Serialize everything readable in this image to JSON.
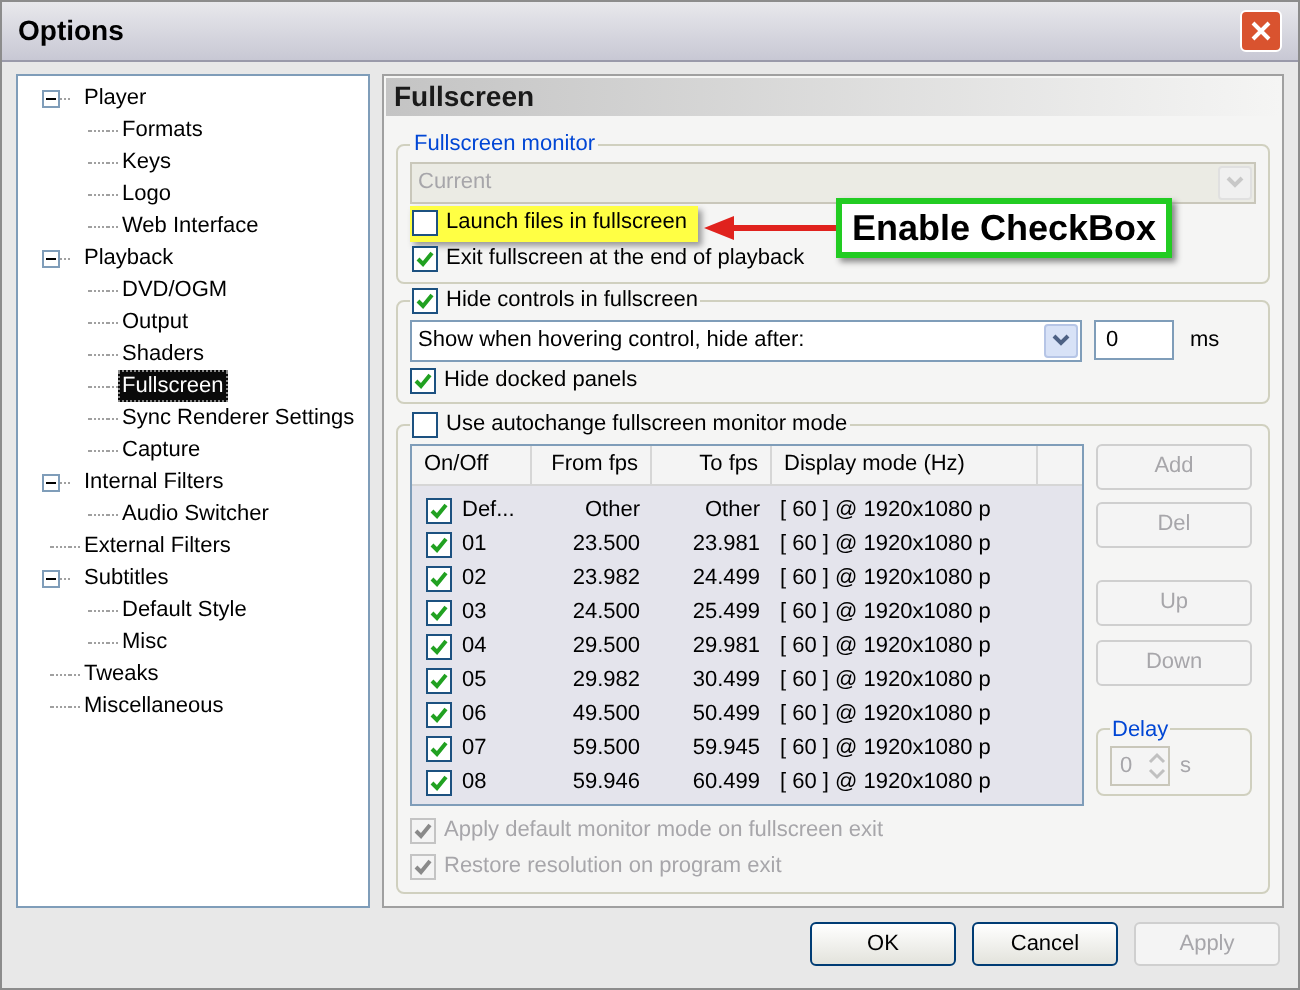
{
  "window": {
    "title": "Options"
  },
  "tree": [
    {
      "label": "Player",
      "expanded": true,
      "selected": false,
      "children": [
        {
          "label": "Formats",
          "selected": false
        },
        {
          "label": "Keys",
          "selected": false
        },
        {
          "label": "Logo",
          "selected": false
        },
        {
          "label": "Web Interface",
          "selected": false
        }
      ]
    },
    {
      "label": "Playback",
      "expanded": true,
      "selected": false,
      "children": [
        {
          "label": "DVD/OGM",
          "selected": false
        },
        {
          "label": "Output",
          "selected": false
        },
        {
          "label": "Shaders",
          "selected": false
        },
        {
          "label": "Fullscreen",
          "selected": true
        },
        {
          "label": "Sync Renderer Settings",
          "selected": false
        },
        {
          "label": "Capture",
          "selected": false
        }
      ]
    },
    {
      "label": "Internal Filters",
      "expanded": true,
      "selected": false,
      "children": [
        {
          "label": "Audio Switcher",
          "selected": false
        }
      ]
    },
    {
      "label": "External Filters",
      "selected": false
    },
    {
      "label": "Subtitles",
      "expanded": true,
      "selected": false,
      "children": [
        {
          "label": "Default Style",
          "selected": false
        },
        {
          "label": "Misc",
          "selected": false
        }
      ]
    },
    {
      "label": "Tweaks",
      "selected": false
    },
    {
      "label": "Miscellaneous",
      "selected": false
    }
  ],
  "panel": {
    "title": "Fullscreen",
    "monitor_group": {
      "label": "Fullscreen monitor",
      "dropdown": {
        "value": "Current",
        "disabled": true
      },
      "checkboxes": [
        {
          "label": "Launch files in fullscreen",
          "checked": false,
          "highlighted": true
        },
        {
          "label": "Exit fullscreen at the end of playback",
          "checked": true,
          "highlighted": false
        }
      ]
    },
    "controls_group": {
      "label": "Hide controls in fullscreen",
      "checked": true,
      "dropdown": {
        "value": "Show when hovering control, hide after:"
      },
      "delay": {
        "value": "0",
        "unit": "ms"
      },
      "docked": {
        "label": "Hide docked panels",
        "checked": true
      }
    },
    "autochange_group": {
      "label": "Use autochange fullscreen monitor mode",
      "checked": false,
      "table": {
        "columns": [
          "On/Off",
          "From fps",
          "To fps",
          "Display mode (Hz)"
        ],
        "rows": [
          {
            "checked": true,
            "name": "Def...",
            "from": "Other",
            "to": "Other",
            "mode": "[ 60 ] @ 1920x1080 p"
          },
          {
            "checked": true,
            "name": "01",
            "from": "23.500",
            "to": "23.981",
            "mode": "[ 60 ] @ 1920x1080 p"
          },
          {
            "checked": true,
            "name": "02",
            "from": "23.982",
            "to": "24.499",
            "mode": "[ 60 ] @ 1920x1080 p"
          },
          {
            "checked": true,
            "name": "03",
            "from": "24.500",
            "to": "25.499",
            "mode": "[ 60 ] @ 1920x1080 p"
          },
          {
            "checked": true,
            "name": "04",
            "from": "29.500",
            "to": "29.981",
            "mode": "[ 60 ] @ 1920x1080 p"
          },
          {
            "checked": true,
            "name": "05",
            "from": "29.982",
            "to": "30.499",
            "mode": "[ 60 ] @ 1920x1080 p"
          },
          {
            "checked": true,
            "name": "06",
            "from": "49.500",
            "to": "50.499",
            "mode": "[ 60 ] @ 1920x1080 p"
          },
          {
            "checked": true,
            "name": "07",
            "from": "59.500",
            "to": "59.945",
            "mode": "[ 60 ] @ 1920x1080 p"
          },
          {
            "checked": true,
            "name": "08",
            "from": "59.946",
            "to": "60.499",
            "mode": "[ 60 ] @ 1920x1080 p"
          }
        ]
      },
      "side_buttons": [
        {
          "label": "Add",
          "disabled": true
        },
        {
          "label": "Del",
          "disabled": true
        },
        {
          "label": "Up",
          "disabled": true
        },
        {
          "label": "Down",
          "disabled": true
        }
      ],
      "delay": {
        "label": "Delay",
        "value": "0",
        "unit": "s",
        "disabled": true
      },
      "checkboxes": [
        {
          "label": "Apply default monitor mode on fullscreen exit",
          "checked": true,
          "disabled": true
        },
        {
          "label": "Restore resolution on program exit",
          "checked": true,
          "disabled": true
        }
      ]
    }
  },
  "annotation": {
    "text": "Enable CheckBox"
  },
  "buttons": [
    {
      "label": "OK",
      "disabled": false
    },
    {
      "label": "Cancel",
      "disabled": false
    },
    {
      "label": "Apply",
      "disabled": true
    }
  ]
}
